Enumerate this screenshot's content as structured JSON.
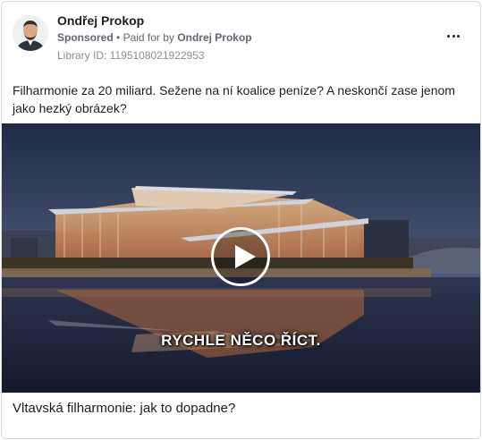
{
  "ad": {
    "author": "Ondřej Prokop",
    "sponsored_label": "Sponsored",
    "paid_for_prefix": "Paid for by",
    "paid_for_by": "Ondrej Prokop",
    "library_id": "Library ID: 1195108021922953",
    "text": "Filharmonie za 20 miliard. Sežene na ní koalice peníze? A neskončí zase jenom jako hezký obrázek?",
    "video_caption": "RYCHLE NĚCO ŘÍCT.",
    "link_title": "Vltavská filharmonie: jak to dopadne?"
  },
  "icons": {
    "menu": "more-dots-icon",
    "play": "play-icon"
  },
  "colors": {
    "name": "#1c1e21",
    "meta": "#65676b",
    "border": "#d7d9dd"
  }
}
